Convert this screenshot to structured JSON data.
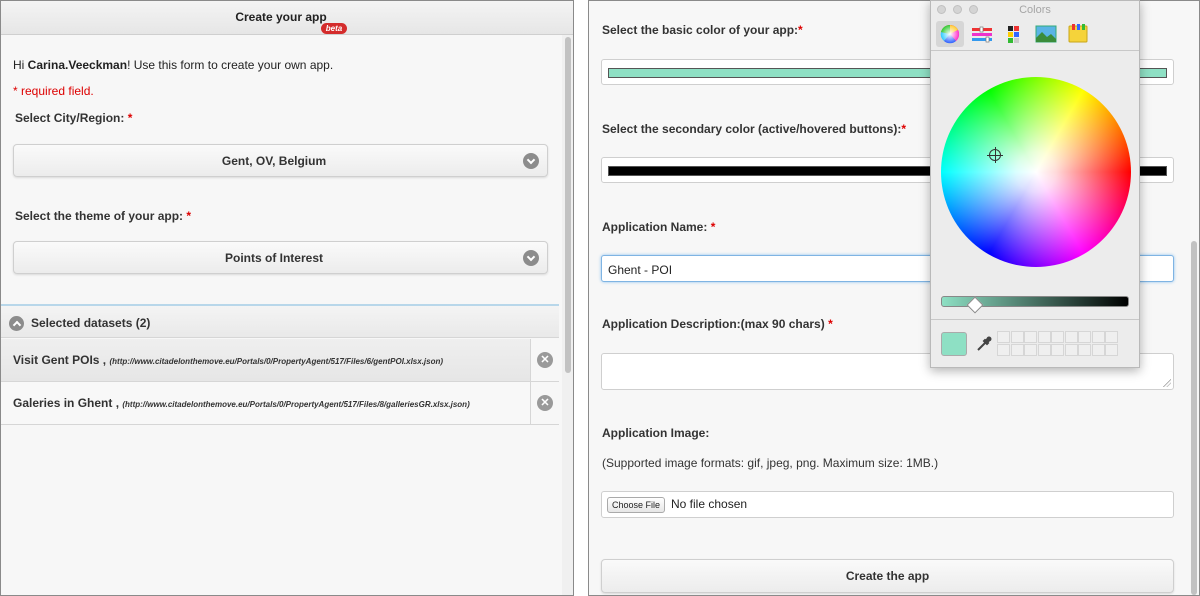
{
  "left": {
    "header_title": "Create your app",
    "beta_badge": "beta",
    "greeting_prefix": "Hi ",
    "greeting_user": "Carina.Veeckman",
    "greeting_suffix": "! Use this form to create your own app.",
    "required_note": "* required field.",
    "city_label": "Select City/Region:",
    "city_value": "Gent, OV, Belgium",
    "theme_label": "Select the theme of your app:",
    "theme_value": "Points of Interest",
    "required_star": "*",
    "datasets_header": "Selected datasets (2)",
    "datasets": [
      {
        "name": "Visit Gent POIs ,",
        "url": "(http://www.citadelonthemove.eu/Portals/0/PropertyAgent/517/Files/6/gentPOI.xlsx.json)"
      },
      {
        "name": "Galeries in Ghent ,",
        "url": "(http://www.citadelonthemove.eu/Portals/0/PropertyAgent/517/Files/8/galleriesGR.xlsx.json)"
      }
    ],
    "remove_icon": "x-circle-icon"
  },
  "right": {
    "basic_color_label": "Select the basic color of your app:",
    "basic_color": "#8ee0c4",
    "secondary_color_label": "Select the secondary color (active/hovered buttons):",
    "secondary_color": "#000000",
    "app_name_label": "Application Name:",
    "app_name_value": "Ghent - POI",
    "app_desc_label": "Application Description:(max 90 chars)",
    "app_desc_value": "",
    "app_image_label": "Application Image:",
    "app_image_note": "(Supported image formats: gif, jpeg, png. Maximum size: 1MB.)",
    "choose_file_label": "Choose File",
    "no_file_text": "No file chosen",
    "create_button": "Create the app",
    "required_star": "*"
  },
  "color_picker": {
    "title": "Colors",
    "modes": [
      "color-wheel-icon",
      "sliders-icon",
      "palettes-icon",
      "image-palettes-icon",
      "crayons-icon"
    ],
    "selected_color": "#8ee0c4",
    "brightness_start": "#8ee0c4",
    "brightness_end": "#000000"
  }
}
